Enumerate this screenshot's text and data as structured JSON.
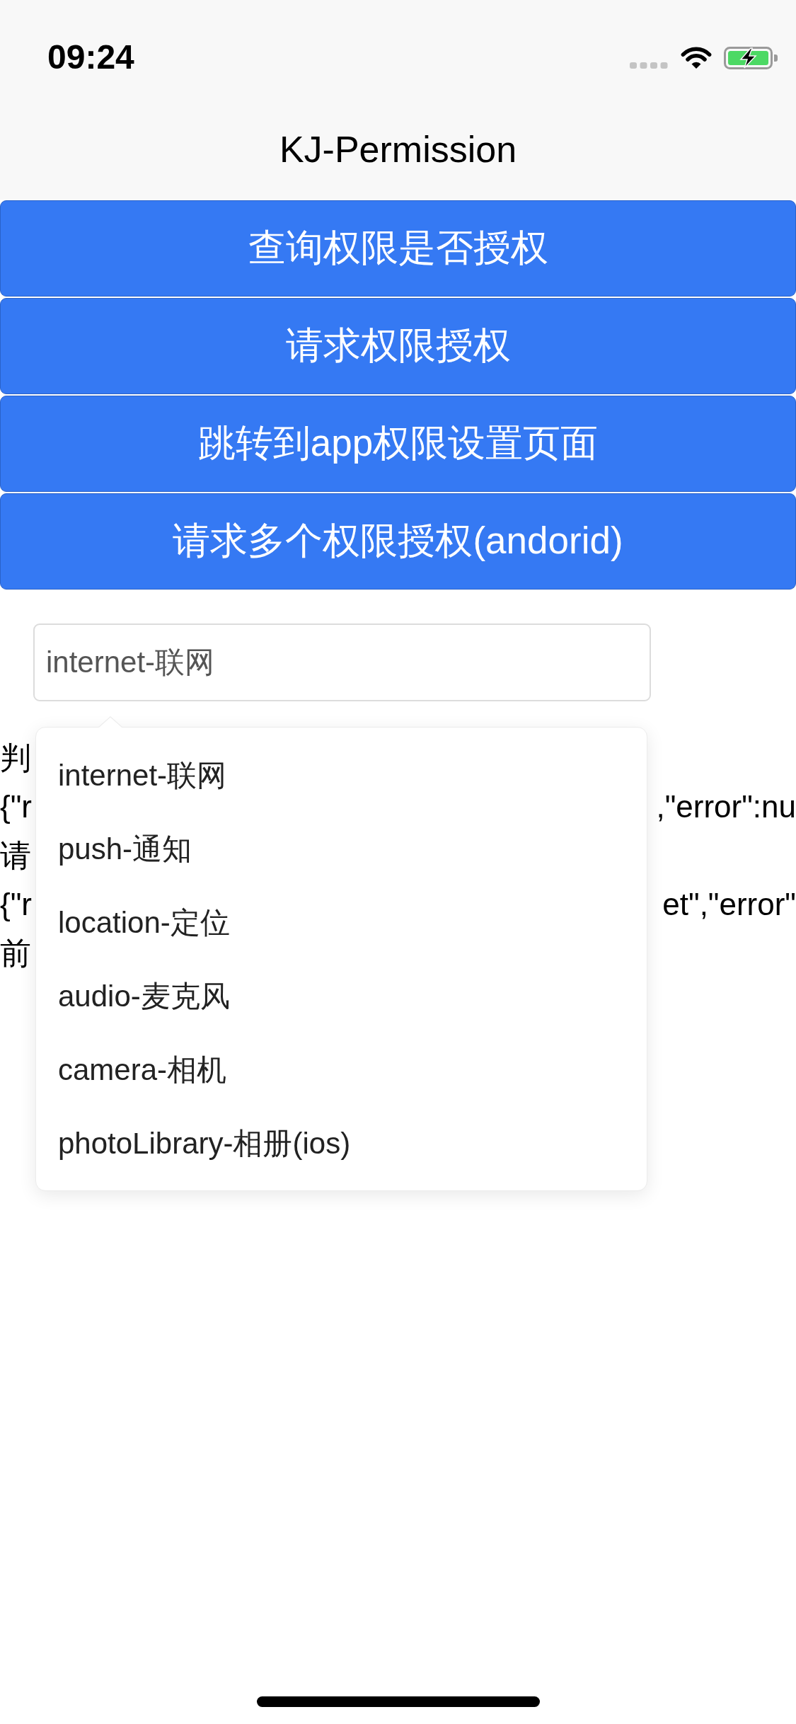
{
  "status_bar": {
    "time": "09:24"
  },
  "nav_bar": {
    "title": "KJ-Permission"
  },
  "buttons": [
    {
      "label": "查询权限是否授权"
    },
    {
      "label": "请求权限授权"
    },
    {
      "label": "跳转到app权限设置页面"
    },
    {
      "label": "请求多个权限授权(andorid)"
    }
  ],
  "permission_field": {
    "value": "internet-联网"
  },
  "dropdown": {
    "open": true,
    "options": [
      "internet-联网",
      "push-通知",
      "location-定位",
      "audio-麦克风",
      "camera-相机",
      "photoLibrary-相册(ios)"
    ]
  },
  "output_lines": [
    {
      "left": "判"
    },
    {
      "left": "{\"r",
      "right": ",\"error\":nu"
    },
    {
      "left": "请"
    },
    {
      "left": "{\"r",
      "right": "et\",\"error\""
    },
    {
      "left": "前"
    }
  ]
}
